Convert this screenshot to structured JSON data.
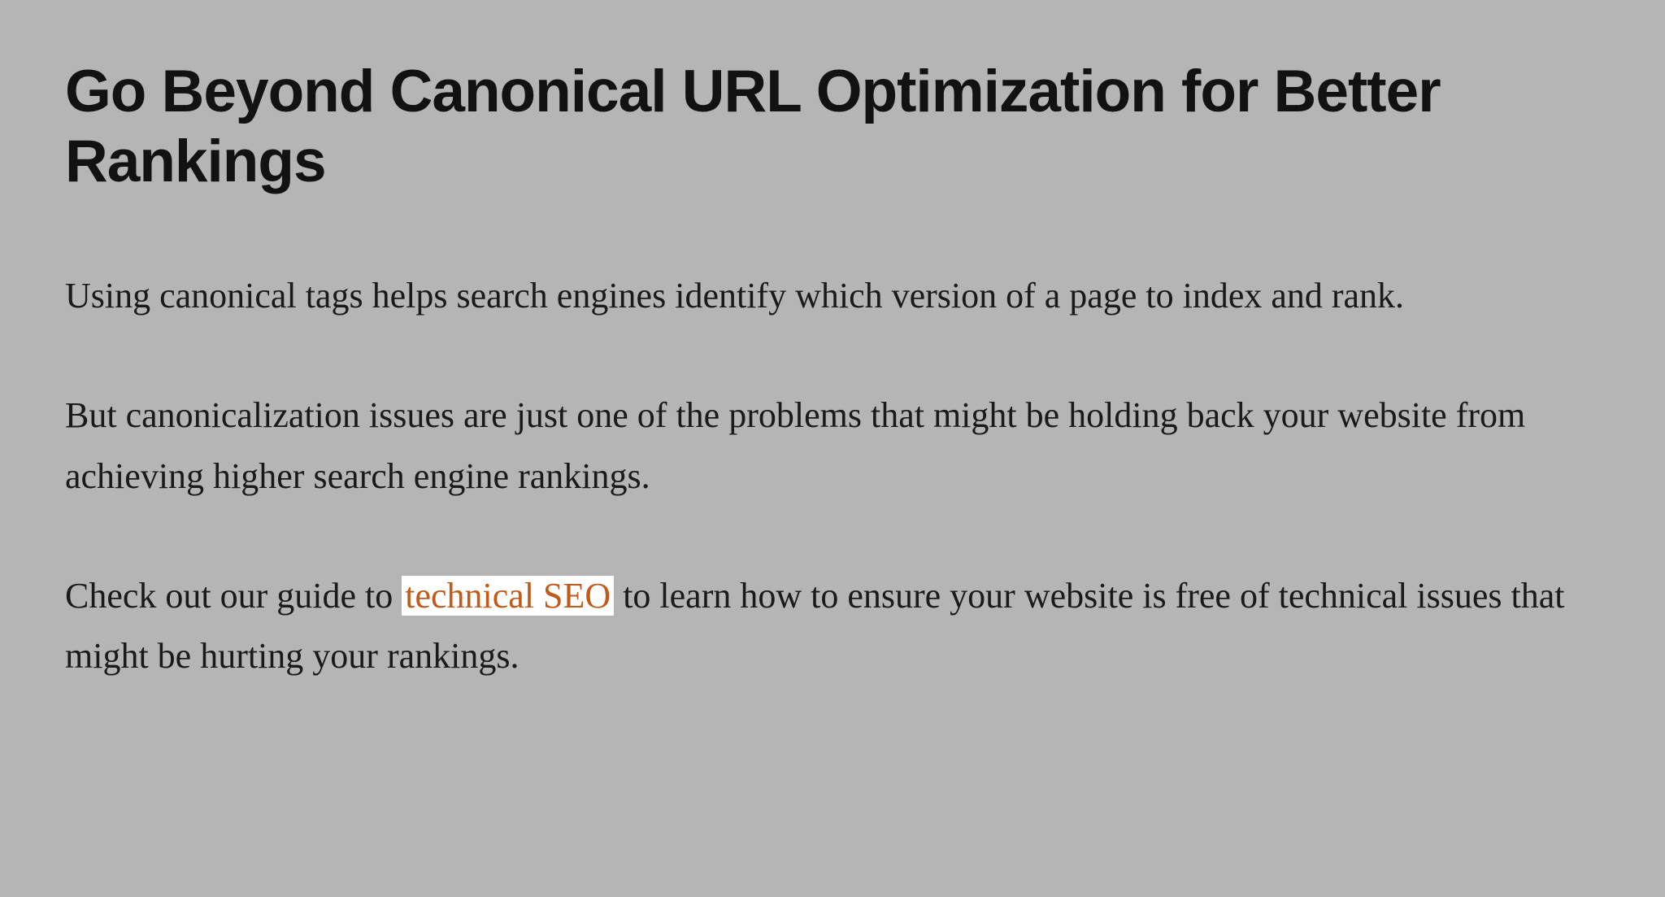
{
  "heading": "Go Beyond Canonical URL Optimization for Better Rankings",
  "paragraphs": {
    "p1": "Using canonical tags helps search engines identify which version of a page to index and rank.",
    "p2": "But canonicalization issues are just one of the problems that might be holding back your website from achieving higher search engine rankings.",
    "p3_pre": "Check out our guide to ",
    "p3_link": "technical SEO",
    "p3_post": " to learn how to ensure your website is free of technical issues that might be hurting your rankings."
  }
}
